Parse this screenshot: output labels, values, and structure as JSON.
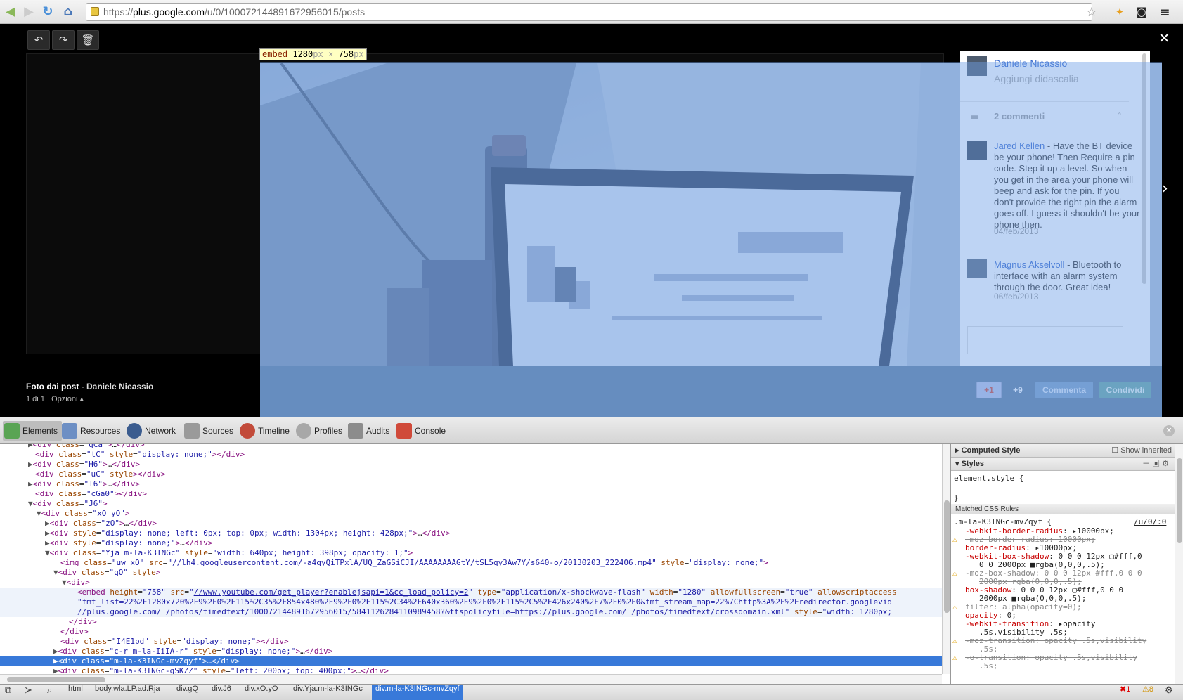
{
  "browser": {
    "url_prefix": "https://",
    "url_host": "plus.google.com",
    "url_path": "/u/0/100072144891672956015/posts"
  },
  "lightbox": {
    "embed_tooltip": {
      "tag": "embed",
      "w": "1280",
      "h": "758",
      "unit": "px",
      "times": "×"
    },
    "author": "Daniele Nicassio",
    "caption_placeholder": "Aggiungi didascalia",
    "comments_count": "2 commenti",
    "comments": [
      {
        "name": "Jared Kellen",
        "text": " - Have the BT device be your phone! Then Require a pin code. Step it up a level. So when you get in the area your phone will beep and ask for the pin. If you don't provide the right pin the alarm goes off. I guess it shouldn't be your phone then.",
        "date": "04/feb/2013"
      },
      {
        "name": "Magnus Akselvoll",
        "text": " - Bluetooth to interface with an alarm system through the door. Great idea!",
        "date": "06/feb/2013"
      }
    ],
    "photo_source_label": "Foto dai post",
    "photo_source_sep": " - ",
    "photo_source_author": "Daniele Nicassio",
    "counter": "1 di 1",
    "options": "Opzioni ▴",
    "plus_one": "+1",
    "plus_count": "+9",
    "comment_btn": "Commenta",
    "share_btn": "Condividi"
  },
  "devtools": {
    "tabs": [
      "Elements",
      "Resources",
      "Network",
      "Sources",
      "Timeline",
      "Profiles",
      "Audits",
      "Console"
    ],
    "styles": {
      "computed_header": "Computed Style",
      "show_inherited": "Show inherited",
      "styles_header": "Styles",
      "element_style_open": "element.style {",
      "element_style_close": "}",
      "matched_header": "Matched CSS Rules",
      "rule_selector": ".m-la-K3INGc-mvZqyf {",
      "rule_source": "/u/0/:0"
    },
    "breadcrumbs": [
      "html",
      "body.wla.LP.ad.Rja",
      "div.gQ",
      "div.J6",
      "div.xO.yO",
      "div.Yja.m-la-K3INGc",
      "div.m-la-K3INGc-mvZqyf"
    ],
    "errors": "1",
    "warnings": "8"
  },
  "colors": {
    "highlight": "#3879d9",
    "overlay": "#6fa0e6",
    "bottom_bar": "#5f7f9f"
  }
}
